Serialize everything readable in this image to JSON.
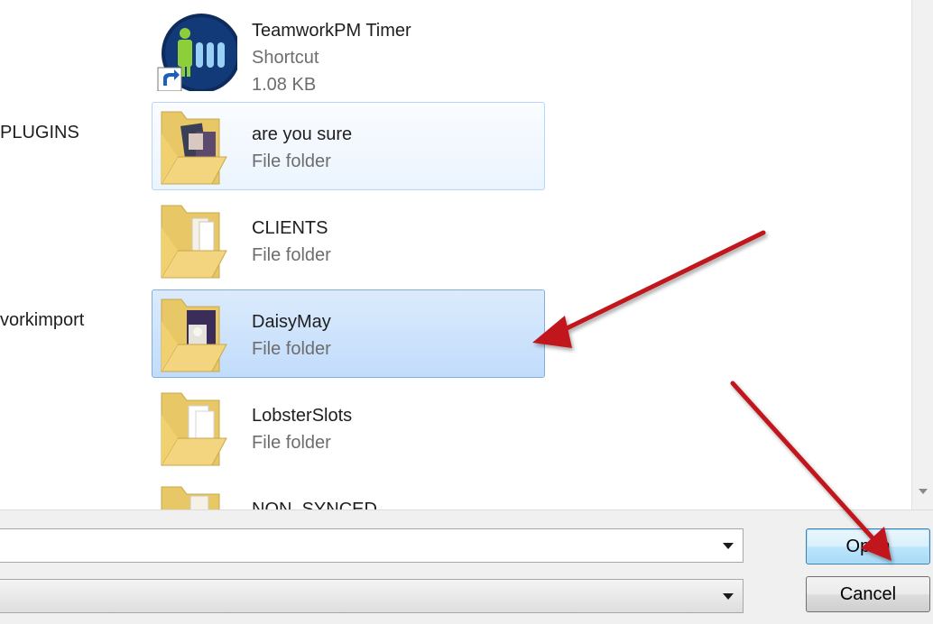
{
  "nav": {
    "items": [
      {
        "label": "PLUGINS"
      },
      {
        "label": "vorkimport"
      }
    ]
  },
  "files": [
    {
      "name": "TeamworkPM Timer",
      "type": "Shortcut",
      "size": "1.08 KB"
    },
    {
      "name": "are you sure",
      "type": "File folder"
    },
    {
      "name": "CLIENTS",
      "type": "File folder"
    },
    {
      "name": "DaisyMay",
      "type": "File folder"
    },
    {
      "name": "LobsterSlots",
      "type": "File folder"
    },
    {
      "name": "NON_SYNCED",
      "type": ""
    }
  ],
  "dialog": {
    "filename_value": "",
    "filetype_value": "",
    "open_label": "Open",
    "cancel_label": "Cancel"
  },
  "colors": {
    "annotation_arrow": "#c0151b",
    "selection": "#c1dcfc",
    "hover": "#ebf4fe"
  }
}
